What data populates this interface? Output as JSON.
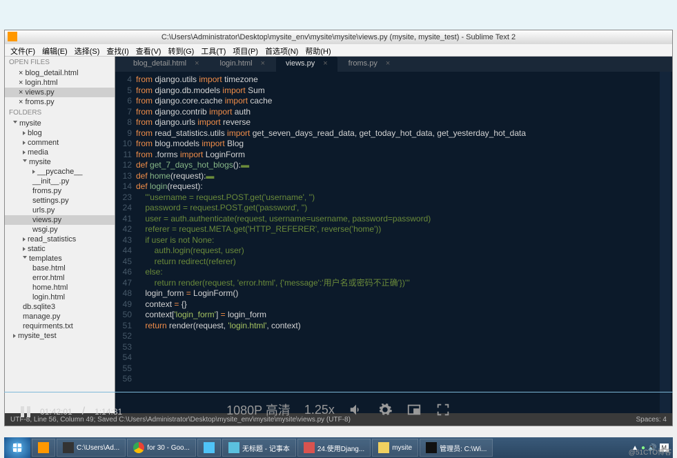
{
  "titlebar": "C:\\Users\\Administrator\\Desktop\\mysite_env\\mysite\\mysite\\views.py (mysite, mysite_test) - Sublime Text 2",
  "menu": [
    "文件(F)",
    "编辑(E)",
    "选择(S)",
    "查找(I)",
    "查看(V)",
    "转到(G)",
    "工具(T)",
    "项目(P)",
    "首选项(N)",
    "帮助(H)"
  ],
  "sidebar": {
    "open_files_hdr": "OPEN FILES",
    "open_files": [
      "blog_detail.html",
      "login.html",
      "views.py",
      "froms.py"
    ],
    "folders_hdr": "FOLDERS",
    "tree": [
      {
        "l": "mysite",
        "d": 0,
        "open": true
      },
      {
        "l": "blog",
        "d": 1
      },
      {
        "l": "comment",
        "d": 1
      },
      {
        "l": "media",
        "d": 1
      },
      {
        "l": "mysite",
        "d": 1,
        "open": true
      },
      {
        "l": "__pycache__",
        "d": 2
      },
      {
        "l": "__init__.py",
        "d": 2,
        "f": true
      },
      {
        "l": "froms.py",
        "d": 2,
        "f": true
      },
      {
        "l": "settings.py",
        "d": 2,
        "f": true
      },
      {
        "l": "urls.py",
        "d": 2,
        "f": true
      },
      {
        "l": "views.py",
        "d": 2,
        "f": true,
        "sel": true
      },
      {
        "l": "wsgi.py",
        "d": 2,
        "f": true
      },
      {
        "l": "read_statistics",
        "d": 1
      },
      {
        "l": "static",
        "d": 1
      },
      {
        "l": "templates",
        "d": 1,
        "open": true
      },
      {
        "l": "base.html",
        "d": 2,
        "f": true
      },
      {
        "l": "error.html",
        "d": 2,
        "f": true
      },
      {
        "l": "home.html",
        "d": 2,
        "f": true
      },
      {
        "l": "login.html",
        "d": 2,
        "f": true
      },
      {
        "l": "db.sqlite3",
        "d": 1,
        "f": true
      },
      {
        "l": "manage.py",
        "d": 1,
        "f": true
      },
      {
        "l": "requirments.txt",
        "d": 1,
        "f": true
      },
      {
        "l": "mysite_test",
        "d": 0
      }
    ]
  },
  "tabs": [
    {
      "label": "blog_detail.html"
    },
    {
      "label": "login.html"
    },
    {
      "label": "views.py",
      "active": true
    },
    {
      "label": "froms.py"
    }
  ],
  "code": {
    "first_line": 4,
    "lines": [
      [
        [
          "kw",
          "from"
        ],
        [
          "nm",
          " django.utils "
        ],
        [
          "kw",
          "import"
        ],
        [
          "nm",
          " timezone"
        ]
      ],
      [
        [
          "kw",
          "from"
        ],
        [
          "nm",
          " django.db.models "
        ],
        [
          "kw",
          "import"
        ],
        [
          "nm",
          " Sum"
        ]
      ],
      [
        [
          "kw",
          "from"
        ],
        [
          "nm",
          " django.core.cache "
        ],
        [
          "kw",
          "import"
        ],
        [
          "nm",
          " cache"
        ]
      ],
      [
        [
          "kw",
          "from"
        ],
        [
          "nm",
          " django.contrib "
        ],
        [
          "kw",
          "import"
        ],
        [
          "nm",
          " auth"
        ]
      ],
      [
        [
          "kw",
          "from"
        ],
        [
          "nm",
          " django.urls "
        ],
        [
          "kw",
          "import"
        ],
        [
          "nm",
          " reverse"
        ]
      ],
      [
        [
          "nm",
          ""
        ]
      ],
      [
        [
          "kw",
          "from"
        ],
        [
          "nm",
          " read_statistics.utils "
        ],
        [
          "kw",
          "import"
        ],
        [
          "nm",
          " get_seven_days_read_data, get_today_hot_data, get_yesterday_hot_data"
        ]
      ],
      [
        [
          "kw",
          "from"
        ],
        [
          "nm",
          " blog.models "
        ],
        [
          "kw",
          "import"
        ],
        [
          "nm",
          " Blog"
        ]
      ],
      [
        [
          "kw",
          "from"
        ],
        [
          "nm",
          " .forms "
        ],
        [
          "kw",
          "import"
        ],
        [
          "nm",
          " LoginForm"
        ]
      ],
      [
        [
          "nm",
          ""
        ]
      ],
      [
        [
          "kw",
          "def "
        ],
        [
          "fn",
          "get_7_days_hot_blogs"
        ],
        [
          "nm",
          "():"
        ],
        [
          "cm",
          "▬"
        ]
      ],
      [
        [
          "nm",
          ""
        ]
      ],
      [
        [
          "kw",
          "def "
        ],
        [
          "fn",
          "home"
        ],
        [
          "nm",
          "(request):"
        ],
        [
          "cm",
          "▬"
        ]
      ],
      [
        [
          "nm",
          ""
        ]
      ],
      [
        [
          "kw",
          "def "
        ],
        [
          "fn",
          "login"
        ],
        [
          "nm",
          "(request):"
        ]
      ],
      [
        [
          "nm",
          "    "
        ],
        [
          "cm",
          "'''username = request.POST.get('username', '')"
        ]
      ],
      [
        [
          "nm",
          "    "
        ],
        [
          "cm",
          "password = request.POST.get('password', '')"
        ]
      ],
      [
        [
          "nm",
          "    "
        ],
        [
          "cm",
          "user = auth.authenticate(request, username=username, password=password)"
        ]
      ],
      [
        [
          "nm",
          "    "
        ],
        [
          "cm",
          "referer = request.META.get('HTTP_REFERER', reverse('home'))"
        ]
      ],
      [
        [
          "nm",
          "    "
        ],
        [
          "cm",
          "if user is not None:"
        ]
      ],
      [
        [
          "nm",
          "        "
        ],
        [
          "cm",
          "auth.login(request, user)"
        ]
      ],
      [
        [
          "nm",
          "        "
        ],
        [
          "cm",
          "return redirect(referer)"
        ]
      ],
      [
        [
          "nm",
          "    "
        ],
        [
          "cm",
          "else:"
        ]
      ],
      [
        [
          "nm",
          "        "
        ],
        [
          "cm",
          "return render(request, 'error.html', {'message':'用户名或密码不正确'})'''"
        ]
      ],
      [
        [
          "nm",
          ""
        ]
      ],
      [
        [
          "nm",
          "    login_form "
        ],
        [
          "op",
          "="
        ],
        [
          "nm",
          " LoginForm()"
        ]
      ],
      [
        [
          "nm",
          "    context "
        ],
        [
          "op",
          "="
        ],
        [
          "nm",
          " {}"
        ]
      ],
      [
        [
          "nm",
          "    context["
        ],
        [
          "st",
          "'login_form'"
        ],
        [
          "nm",
          "] "
        ],
        [
          "op",
          "="
        ],
        [
          "nm",
          " login_form"
        ]
      ],
      [
        [
          "nm",
          "    "
        ],
        [
          "kw",
          "return"
        ],
        [
          "nm",
          " render(request, "
        ],
        [
          "st",
          "'login.html'"
        ],
        [
          "nm",
          ", context)"
        ]
      ]
    ],
    "line_numbers": [
      4,
      5,
      6,
      7,
      8,
      9,
      10,
      11,
      12,
      13,
      14,
      23,
      24,
      41,
      42,
      43,
      44,
      45,
      46,
      47,
      48,
      49,
      50,
      51,
      52,
      53,
      54,
      55,
      56
    ]
  },
  "status": {
    "left": "UTF-8, Line 56, Column 49; Saved C:\\Users\\Administrator\\Desktop\\mysite_env\\mysite\\mysite\\views.py (UTF-8)",
    "right": "Spaces: 4"
  },
  "overlay": {
    "time_cur": "01:42:01",
    "time_total": "1:14:31",
    "quality": "1080P 高清",
    "speed": "1.25x"
  },
  "taskbar": [
    {
      "label": "",
      "color": "#ff9800"
    },
    {
      "label": "C:\\Users\\Ad...",
      "color": "#333"
    },
    {
      "label": "for 30 - Goo...",
      "color": "#fff",
      "chrome": true
    },
    {
      "label": "",
      "color": "#4fc3f7"
    },
    {
      "label": "无标题 - 记事本",
      "color": "#5bc0de"
    },
    {
      "label": "24.使用Djang...",
      "color": "#d9534f"
    },
    {
      "label": "mysite",
      "color": "#f0d060"
    },
    {
      "label": "管理员: C:\\Wi...",
      "color": "#111"
    }
  ],
  "watermark": "@51CTO博客"
}
